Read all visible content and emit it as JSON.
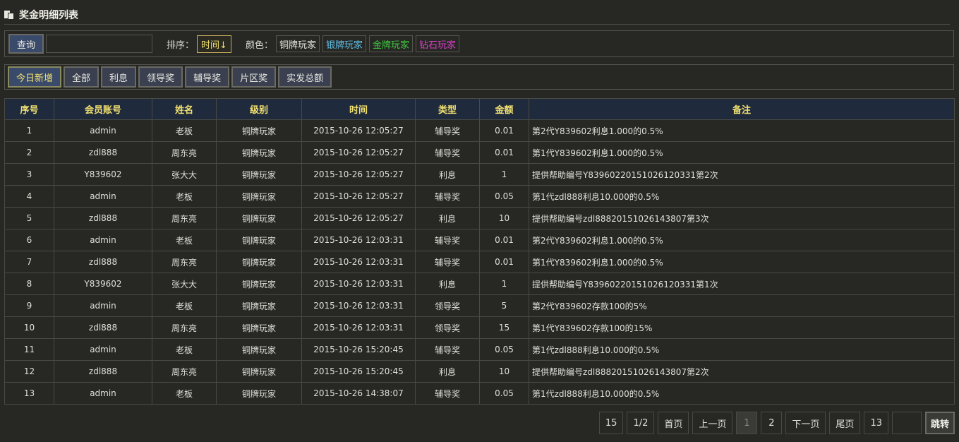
{
  "title": "奖金明细列表",
  "filter": {
    "query_label": "查询",
    "search_value": "",
    "sort_label": "排序：",
    "sort_value": "时间↓",
    "color_label": "颜色：",
    "color_tags": [
      "铜牌玩家",
      "银牌玩家",
      "金牌玩家",
      "钻石玩家"
    ]
  },
  "tabs": [
    "今日新增",
    "全部",
    "利息",
    "领导奖",
    "辅导奖",
    "片区奖",
    "实发总额"
  ],
  "table": {
    "headers": [
      "序号",
      "会员账号",
      "姓名",
      "级别",
      "时间",
      "类型",
      "金额",
      "备注"
    ],
    "rows": [
      [
        "1",
        "admin",
        "老板",
        "铜牌玩家",
        "2015-10-26 12:05:27",
        "辅导奖",
        "0.01",
        "第2代Y839602利息1.000的0.5%"
      ],
      [
        "2",
        "zdl888",
        "周东亮",
        "铜牌玩家",
        "2015-10-26 12:05:27",
        "辅导奖",
        "0.01",
        "第1代Y839602利息1.000的0.5%"
      ],
      [
        "3",
        "Y839602",
        "张大大",
        "铜牌玩家",
        "2015-10-26 12:05:27",
        "利息",
        "1",
        "提供帮助编号Y83960220151026120331第2次"
      ],
      [
        "4",
        "admin",
        "老板",
        "铜牌玩家",
        "2015-10-26 12:05:27",
        "辅导奖",
        "0.05",
        "第1代zdl888利息10.000的0.5%"
      ],
      [
        "5",
        "zdl888",
        "周东亮",
        "铜牌玩家",
        "2015-10-26 12:05:27",
        "利息",
        "10",
        "提供帮助编号zdl88820151026143807第3次"
      ],
      [
        "6",
        "admin",
        "老板",
        "铜牌玩家",
        "2015-10-26 12:03:31",
        "辅导奖",
        "0.01",
        "第2代Y839602利息1.000的0.5%"
      ],
      [
        "7",
        "zdl888",
        "周东亮",
        "铜牌玩家",
        "2015-10-26 12:03:31",
        "辅导奖",
        "0.01",
        "第1代Y839602利息1.000的0.5%"
      ],
      [
        "8",
        "Y839602",
        "张大大",
        "铜牌玩家",
        "2015-10-26 12:03:31",
        "利息",
        "1",
        "提供帮助编号Y83960220151026120331第1次"
      ],
      [
        "9",
        "admin",
        "老板",
        "铜牌玩家",
        "2015-10-26 12:03:31",
        "领导奖",
        "5",
        "第2代Y839602存款100的5%"
      ],
      [
        "10",
        "zdl888",
        "周东亮",
        "铜牌玩家",
        "2015-10-26 12:03:31",
        "领导奖",
        "15",
        "第1代Y839602存款100的15%"
      ],
      [
        "11",
        "admin",
        "老板",
        "铜牌玩家",
        "2015-10-26 15:20:45",
        "辅导奖",
        "0.05",
        "第1代zdl888利息10.000的0.5%"
      ],
      [
        "12",
        "zdl888",
        "周东亮",
        "铜牌玩家",
        "2015-10-26 15:20:45",
        "利息",
        "10",
        "提供帮助编号zdl88820151026143807第2次"
      ],
      [
        "13",
        "admin",
        "老板",
        "铜牌玩家",
        "2015-10-26 14:38:07",
        "辅导奖",
        "0.05",
        "第1代zdl888利息10.000的0.5%"
      ]
    ]
  },
  "pager": {
    "total": "15",
    "pages": "1/2",
    "first": "首页",
    "prev": "上一页",
    "page_numbers": [
      "1",
      "2"
    ],
    "current_page": "1",
    "next": "下一页",
    "last": "尾页",
    "per_page": "13",
    "jump_label": "跳转"
  },
  "colors": {
    "accent_yellow": "#f0e070",
    "header_bg": "#1f2a3c",
    "silver": "#5fc0e8",
    "gold": "#3ec83e",
    "diamond": "#d83ec8"
  }
}
